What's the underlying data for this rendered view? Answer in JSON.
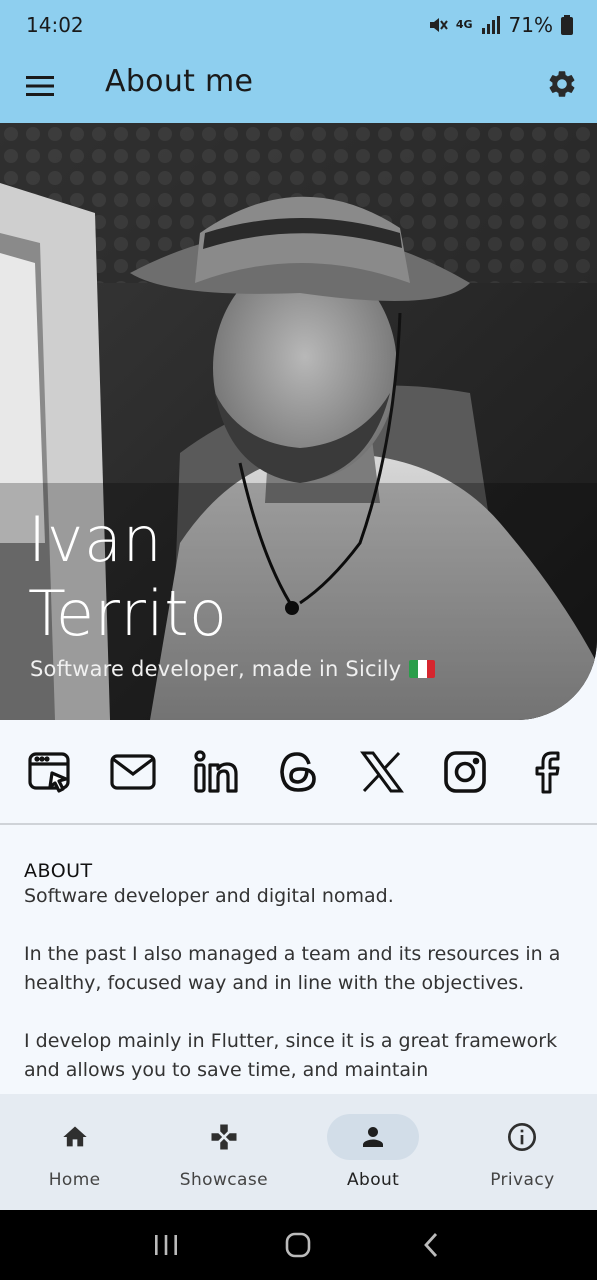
{
  "status": {
    "time": "14:02",
    "network": "4G",
    "battery": "71%",
    "icons": [
      "mute-icon",
      "network-4g-icon",
      "signal-icon",
      "battery-icon"
    ]
  },
  "appbar": {
    "title": "About me",
    "menu_icon": "menu-icon",
    "settings_icon": "gear-icon",
    "background": "#8ecfef"
  },
  "hero": {
    "first_name": "Ivan",
    "last_name": "Territo",
    "subtitle": "Software developer, made in Sicily",
    "flag": "italy-flag-icon"
  },
  "socials": [
    {
      "name": "website",
      "icon": "web-icon"
    },
    {
      "name": "email",
      "icon": "mail-icon"
    },
    {
      "name": "linkedin",
      "icon": "linkedin-icon"
    },
    {
      "name": "threads",
      "icon": "threads-icon"
    },
    {
      "name": "x",
      "icon": "x-icon"
    },
    {
      "name": "instagram",
      "icon": "instagram-icon"
    },
    {
      "name": "facebook",
      "icon": "facebook-icon"
    }
  ],
  "about": {
    "heading": "ABOUT",
    "paragraphs": [
      "Software developer and digital nomad.",
      "In the past I also managed a team and its resources in a healthy, focused way and in line with the objectives.",
      "I develop mainly in Flutter, since it is a great framework and allows you to save time, and maintain"
    ]
  },
  "bottom_nav": {
    "items": [
      {
        "label": "Home",
        "icon": "home-icon",
        "active": false
      },
      {
        "label": "Showcase",
        "icon": "gamepad-icon",
        "active": false
      },
      {
        "label": "About",
        "icon": "person-icon",
        "active": true
      },
      {
        "label": "Privacy",
        "icon": "info-icon",
        "active": false
      }
    ]
  },
  "system_nav": [
    "recents-icon",
    "home-circle-icon",
    "back-icon"
  ]
}
